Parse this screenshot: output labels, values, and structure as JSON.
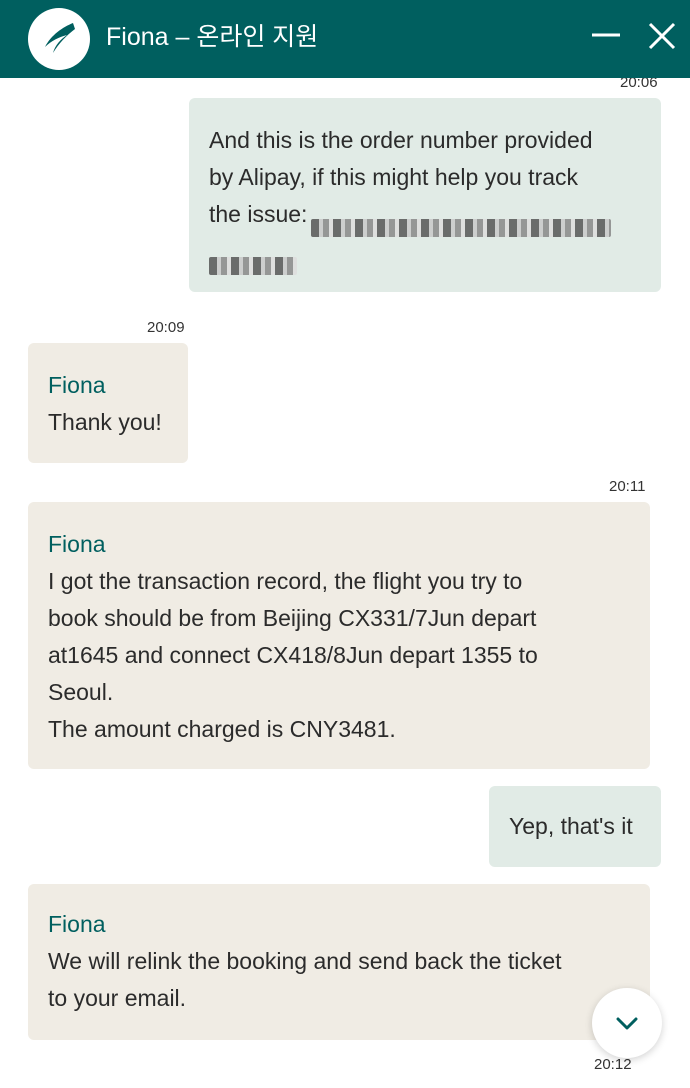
{
  "header": {
    "title": "Fiona – 온라인 지원"
  },
  "messages": {
    "m1": {
      "time_top": "20:06",
      "lines": "And this is the order number provided\nby Alipay, if this might help you track\nthe issue:"
    },
    "m2": {
      "time": "20:09",
      "sender": "Fiona",
      "text": "Thank you!"
    },
    "m3": {
      "time": "20:11",
      "sender": "Fiona",
      "text": "I got the transaction record, the flight you try to\nbook should be from Beijing CX331/7Jun depart\nat1645 and connect CX418/8Jun depart 1355 to\nSeoul.\nThe amount charged is CNY3481."
    },
    "m4": {
      "text": "Yep, that's it"
    },
    "m5": {
      "sender": "Fiona",
      "text": "We will relink the booking and send back the ticket\nto your email.",
      "time": "20:12"
    }
  },
  "colors": {
    "header_bg": "#005f5f",
    "user_bubble": "#e1ebe6",
    "agent_bubble": "#f0ece4",
    "sender_name": "#005f5f"
  },
  "icons": {
    "logo": "brushwing-logo-icon",
    "minimize": "minimize-icon",
    "close": "close-icon",
    "scroll": "chevron-down-icon"
  }
}
